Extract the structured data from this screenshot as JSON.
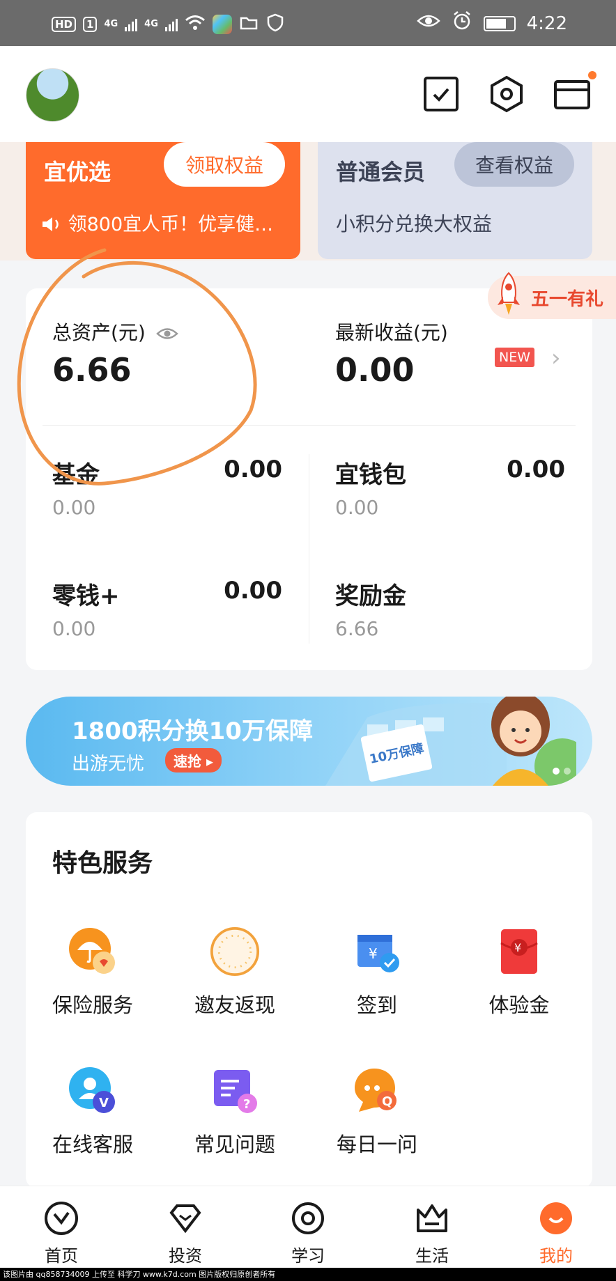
{
  "status_bar": {
    "hd_label": "HD",
    "sim_label": "1",
    "net1": "4G",
    "net2": "4G",
    "time": "4:22"
  },
  "header": {
    "avatar_alt": "avatar"
  },
  "promo": {
    "left": {
      "title": "宜优选",
      "button": "领取权益",
      "subtitle": "领800宜人币！优享健…"
    },
    "right": {
      "title": "普通会员",
      "button": "查看权益",
      "subtitle": "小积分兑换大权益"
    }
  },
  "gift_badge": {
    "label": "五一有礼"
  },
  "assets": {
    "total_label": "总资产(元)",
    "total_value": "6.66",
    "latest_label": "最新收益(元)",
    "latest_value": "0.00",
    "new_badge": "NEW",
    "items": [
      {
        "name": "基金",
        "value": "0.00",
        "sub": "0.00"
      },
      {
        "name": "宜钱包",
        "value": "0.00",
        "sub": "0.00"
      },
      {
        "name": "零钱+",
        "value": "0.00",
        "sub": "0.00"
      },
      {
        "name": "奖励金",
        "value": "",
        "sub": "6.66"
      }
    ]
  },
  "banner": {
    "title": "1800积分换10万保障",
    "subtitle": "出游无忧",
    "button": "速抢 ▸",
    "card_text": "10万保障"
  },
  "services": {
    "title": "特色服务",
    "items": [
      {
        "label": "保险服务",
        "icon": "umbrella-icon"
      },
      {
        "label": "邀友返现",
        "icon": "invite-icon"
      },
      {
        "label": "签到",
        "icon": "checkin-icon"
      },
      {
        "label": "体验金",
        "icon": "red-envelope-icon"
      },
      {
        "label": "在线客服",
        "icon": "customer-service-icon"
      },
      {
        "label": "常见问题",
        "icon": "faq-icon"
      },
      {
        "label": "每日一问",
        "icon": "daily-question-icon"
      }
    ]
  },
  "tabbar": {
    "items": [
      {
        "label": "首页",
        "icon": "home-icon"
      },
      {
        "label": "投资",
        "icon": "invest-icon"
      },
      {
        "label": "学习",
        "icon": "learn-icon"
      },
      {
        "label": "生活",
        "icon": "life-icon"
      },
      {
        "label": "我的",
        "icon": "me-icon"
      }
    ],
    "active_color": "#ff6b2c"
  },
  "footer": {
    "text": "该图片由 qq858734009 上传至 科学刀 www.k7d.com 图片版权归原创者所有"
  },
  "colors": {
    "accent": "#ff6b2c",
    "member": "#dde1ee",
    "badge_red": "#f2554f"
  }
}
